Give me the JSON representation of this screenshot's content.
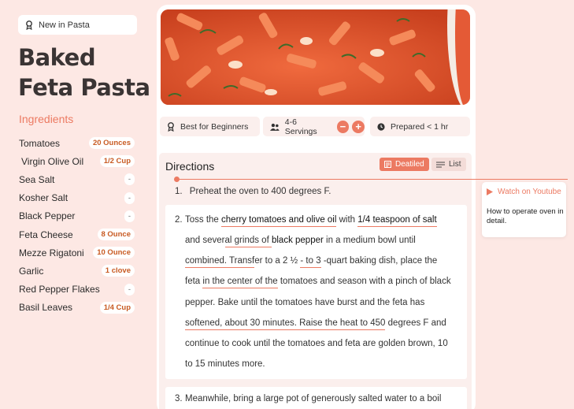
{
  "badge": {
    "label": "New in Pasta",
    "icon": "award-icon"
  },
  "title": "Baked Feta Pasta",
  "ingredients": {
    "heading": "Ingredients",
    "items": [
      {
        "name": "Tomatoes",
        "qty": "20 Ounces"
      },
      {
        "name": "Virgin Olive Oil",
        "qty": "1/2 Cup"
      },
      {
        "name": "Sea Salt",
        "qty": "-"
      },
      {
        "name": "Kosher Salt",
        "qty": "-"
      },
      {
        "name": "Black Pepper",
        "qty": "-"
      },
      {
        "name": "Feta Cheese",
        "qty": "8 Ounce"
      },
      {
        "name": "Mezze Rigatoni",
        "qty": "10 Ounce"
      },
      {
        "name": "Garlic",
        "qty": "1 clove"
      },
      {
        "name": "Red Pepper Flakes",
        "qty": "-"
      },
      {
        "name": "Basil Leaves",
        "qty": "1/4 Cup"
      }
    ]
  },
  "meta": {
    "level": "Best for Beginners",
    "servings": "4-6 Servings",
    "minus": "−",
    "plus": "+",
    "time": "Prepared < 1 hr"
  },
  "directions": {
    "title": "Directions",
    "toggle_detailed": "Deatiled",
    "toggle_list": "List",
    "step1_num": "1.",
    "step1": "Preheat the oven to 400 degrees F.",
    "step2_num": "2.",
    "step2": {
      "l1a": "Toss the ",
      "l1b": "cherry tomatoes and olive oil",
      "l1c": " with ",
      "l1d": "1/4 teaspoon of salt",
      "l2a": "and sever",
      "l2b": "al grinds of ",
      "l2c": "black pepper",
      "l2d": " in a medium bowl until",
      "l3a": "combined. Transf",
      "l3b": "er to a 2 ½ ",
      "l3c": "- to 3",
      "l3d": " -quart baking dish, place the",
      "l4a": "feta ",
      "l4b": "in the center of the",
      "l4c": " tomatoes and season with a pinch of black",
      "l5": "pepper. Bake until the tomatoes have burst and the feta has",
      "l6a": "softened, about 30 minutes. Raise the heat to 450",
      "l6b": " degrees F and",
      "l7": "continue to cook until the tomatoes and feta are golden brown, 10",
      "l8": "to 15 minutes more."
    },
    "step3_num": "3.",
    "step3": "Meanwhile, bring a large pot of generously salted water to a boil"
  },
  "tooltip": {
    "link": "Watch on Youtube",
    "text": "How to operate oven in detail."
  },
  "colors": {
    "accent": "#ec7a62",
    "background": "#fde8e4",
    "qty_text": "#c85a22"
  }
}
